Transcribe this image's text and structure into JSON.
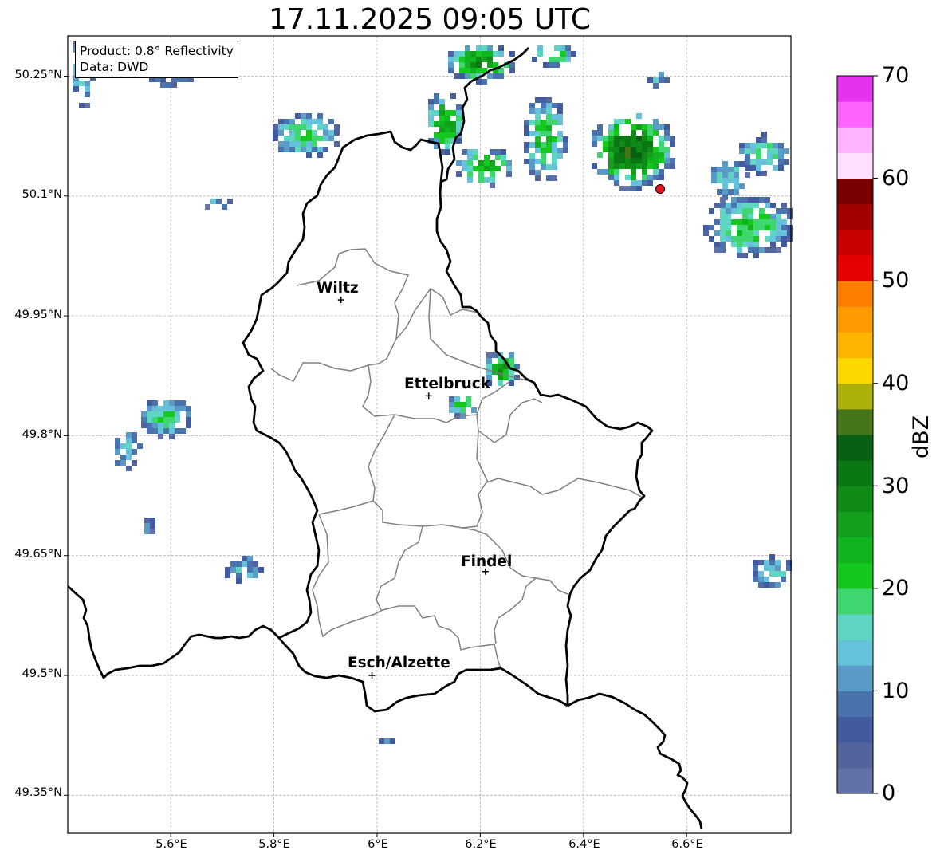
{
  "title": "17.11.2025 09:05 UTC",
  "info": {
    "product": "Product: 0.8° Reflectivity",
    "data": "Data: DWD"
  },
  "lat_labels": [
    "50.25°N",
    "50.1°N",
    "49.95°N",
    "49.8°N",
    "49.65°N",
    "49.5°N",
    "49.35°N"
  ],
  "lon_labels": [
    "5.6°E",
    "5.8°E",
    "6°E",
    "6.2°E",
    "6.4°E",
    "6.6°E"
  ],
  "cities": [
    {
      "name": "Wiltz",
      "lon": 5.93,
      "lat": 49.97
    },
    {
      "name": "Ettelbruck",
      "lon": 6.1,
      "lat": 49.85
    },
    {
      "name": "Findel",
      "lon": 6.21,
      "lat": 49.63
    },
    {
      "name": "Esch/Alzette",
      "lon": 5.99,
      "lat": 49.5
    }
  ],
  "radar_site": {
    "lon": 6.55,
    "lat": 50.11,
    "color": "#e8141e"
  },
  "colorbar": {
    "label": "dBZ",
    "ticks": [
      "0",
      "10",
      "20",
      "30",
      "40",
      "50",
      "60",
      "70"
    ],
    "colors": [
      "#6272a8",
      "#52639e",
      "#425b9e",
      "#4a73ae",
      "#5a9ac6",
      "#66c1db",
      "#5fd6c1",
      "#3fd670",
      "#14c81e",
      "#10b41e",
      "#12a01c",
      "#0f8a14",
      "#0a7614",
      "#086012",
      "#47761a",
      "#acb10a",
      "#ffd700",
      "#ffb400",
      "#ff9b00",
      "#ff7d00",
      "#e60000",
      "#c80000",
      "#a00000",
      "#780000",
      "#ffe0ff",
      "#ffb4ff",
      "#ff64ff",
      "#e632ee"
    ]
  },
  "colors": {
    "country_border": "#000000",
    "canton_border": "#808080",
    "grid": "#b4b4b4"
  }
}
